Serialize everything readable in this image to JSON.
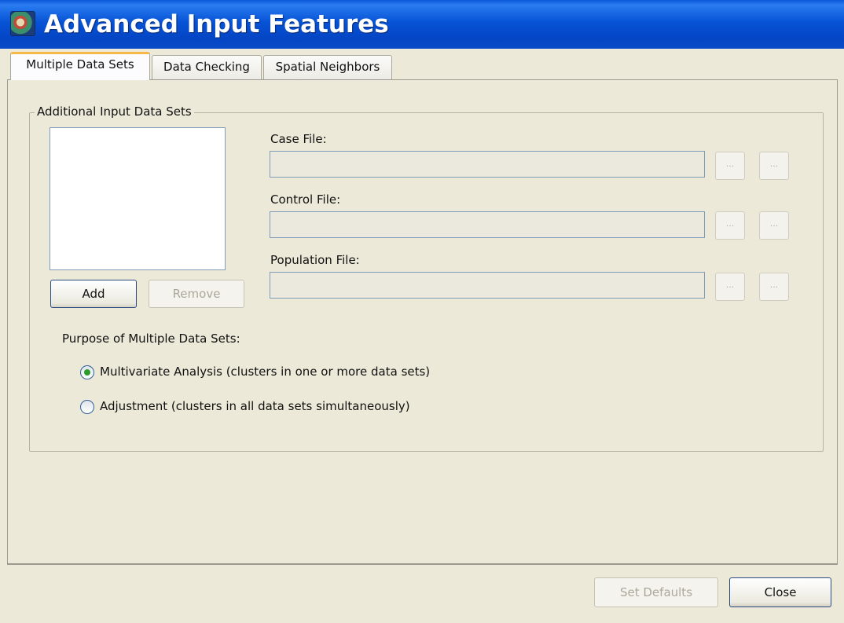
{
  "window": {
    "title": "Advanced Input Features",
    "icon": "app-icon"
  },
  "tabs": [
    {
      "label": "Multiple Data Sets",
      "active": true
    },
    {
      "label": "Data Checking",
      "active": false
    },
    {
      "label": "Spatial Neighbors",
      "active": false
    }
  ],
  "additional_input": {
    "group_label": "Additional Input Data Sets",
    "data_sets": [],
    "add_label": "Add",
    "remove_label": "Remove",
    "case_file": {
      "label": "Case File:",
      "value": "",
      "browse_label": "...",
      "import_label": "..."
    },
    "control_file": {
      "label": "Control File:",
      "value": "",
      "browse_label": "...",
      "import_label": "..."
    },
    "population_file": {
      "label": "Population File:",
      "value": "",
      "browse_label": "...",
      "import_label": "..."
    }
  },
  "purpose": {
    "label": "Purpose of Multiple Data Sets:",
    "options": [
      {
        "label": "Multivariate Analysis (clusters in one or more data sets)",
        "selected": true
      },
      {
        "label": "Adjustment (clusters in all data sets simultaneously)",
        "selected": false
      }
    ]
  },
  "footer": {
    "set_defaults_label": "Set Defaults",
    "close_label": "Close"
  },
  "colors": {
    "titlebar": "#0753d6",
    "window_bg": "#ece9d8",
    "active_tab_accent": "#f7b84a",
    "radio_selected": "#2b9b2b"
  }
}
